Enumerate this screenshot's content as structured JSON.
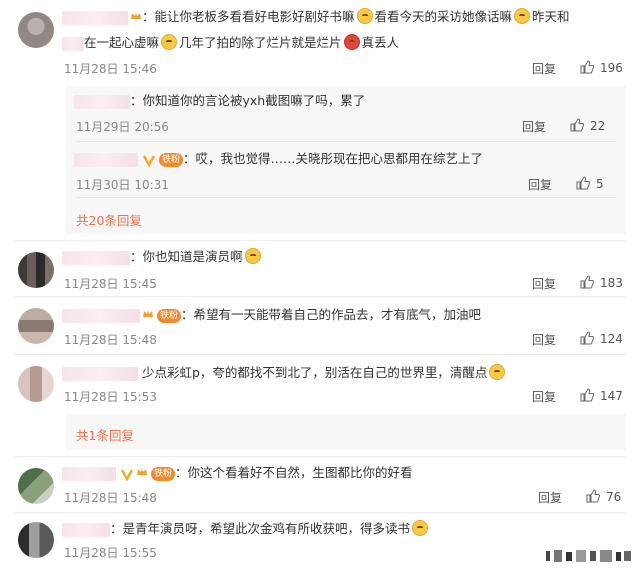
{
  "comments": [
    {
      "text_parts": [
        "能让你老板多看看好电影好剧好书嘛",
        "看看今天的采访她像话嘛",
        "昨天和",
        "在一起心虚嘛",
        "几年了拍的除了烂片就是烂片",
        "真丢人"
      ],
      "time": "11月28日 15:46",
      "reply": "回复",
      "likes": "196"
    },
    {
      "text": "你知道你的言论被yxh截图嘛了吗，累了",
      "time": "11月29日 20:56",
      "reply": "回复",
      "likes": "22"
    },
    {
      "badge": "铁粉",
      "text": "哎，我也觉得……关晓彤现在把心思都用在综艺上了",
      "time": "11月30日 10:31",
      "reply": "回复",
      "likes": "5"
    },
    {
      "text": "你也知道是演员啊",
      "time": "11月28日 15:45",
      "reply": "回复",
      "likes": "183"
    },
    {
      "badge": "铁粉",
      "text": "希望有一天能带着自己的作品去，才有底气，加油吧",
      "time": "11月28日 15:48",
      "reply": "回复",
      "likes": "124"
    },
    {
      "text": "少点彩虹p，夸的都找不到北了，别活在自己的世界里，清醒点",
      "time": "11月28日 15:53",
      "reply": "回复",
      "likes": "147"
    },
    {
      "badge": "铁粉",
      "text": "你这个看着好不自然，生图都比你的好看",
      "time": "11月28日 15:48",
      "reply": "回复",
      "likes": "76"
    },
    {
      "text": "是青年演员呀，希望此次金鸡有所收获吧，得多读书",
      "time": "11月28日 15:55"
    }
  ],
  "more_replies_1": "共20条回复",
  "more_replies_2": "共1条回复",
  "colors": {
    "accent": "#eb7350",
    "text": "#333333",
    "meta": "#888888",
    "subbox": "#f7f7f7"
  },
  "icons": [
    "thumb-up-icon",
    "verified-v-icon",
    "crown-icon",
    "emoji-icon"
  ]
}
